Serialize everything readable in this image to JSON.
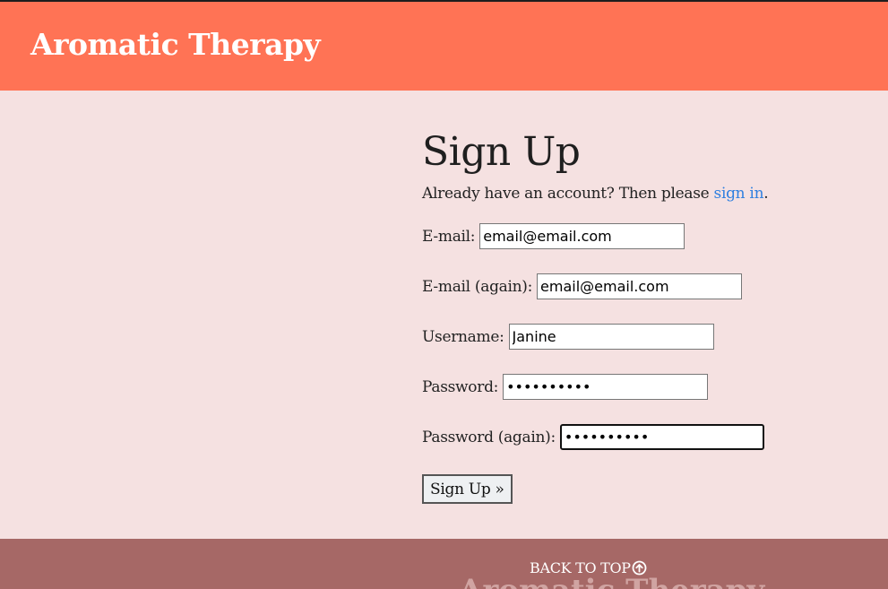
{
  "header": {
    "brand": "Aromatic Therapy"
  },
  "main": {
    "title": "Sign Up",
    "intro_prefix": "Already have an account? Then please ",
    "intro_link": "sign in",
    "intro_suffix": ".",
    "fields": {
      "email": {
        "label": "E-mail:",
        "value": "email@email.com"
      },
      "email_again": {
        "label": "E-mail (again):",
        "value": "email@email.com"
      },
      "username": {
        "label": "Username:",
        "value": "Janine"
      },
      "password": {
        "label": "Password:",
        "value": "••••••••••"
      },
      "password_again": {
        "label": "Password (again):",
        "value": "••••••••••"
      }
    },
    "submit_label": "Sign Up »"
  },
  "footer": {
    "back_to_top": "BACK TO TOP",
    "brand": "Aromatic Therapy"
  },
  "colors": {
    "header_bg": "#ff7355",
    "page_bg": "#f5e1e1",
    "footer_bg": "#a66866",
    "link": "#2f7fe0"
  }
}
